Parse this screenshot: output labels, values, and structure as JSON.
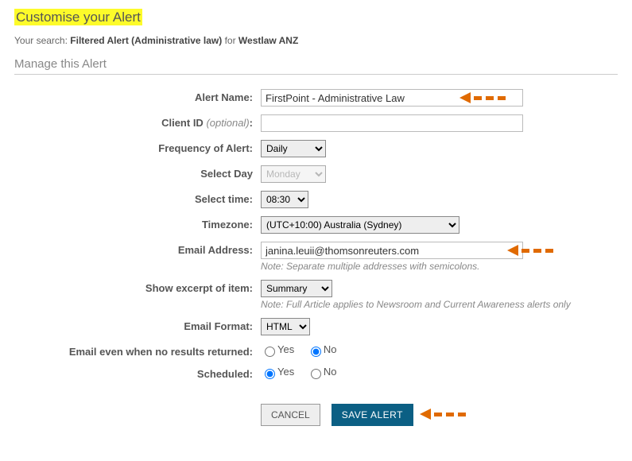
{
  "title": "Customise your Alert",
  "search_line": {
    "prefix": "Your search:",
    "query": "Filtered Alert (Administrative law)",
    "for": "for",
    "db": "Westlaw ANZ"
  },
  "section": "Manage this Alert",
  "labels": {
    "alert_name": "Alert Name:",
    "client_id": "Client ID",
    "client_id_opt": "(optional)",
    "client_id_colon": ":",
    "frequency": "Frequency of Alert:",
    "select_day": "Select Day",
    "select_time": "Select time:",
    "timezone": "Timezone:",
    "email": "Email Address:",
    "excerpt": "Show excerpt of item:",
    "format": "Email Format:",
    "no_results": "Email even when no results returned:",
    "scheduled": "Scheduled:"
  },
  "values": {
    "alert_name": "FirstPoint - Administrative Law",
    "client_id": "",
    "frequency": "Daily",
    "select_day": "Monday",
    "select_time": "08:30",
    "timezone": "(UTC+10:00) Australia (Sydney)",
    "email": "janina.leuii@thomsonreuters.com",
    "excerpt": "Summary",
    "format": "HTML"
  },
  "notes": {
    "email": "Note: Separate multiple addresses with semicolons.",
    "excerpt": "Note: Full Article applies to Newsroom and Current Awareness alerts only"
  },
  "options": {
    "yes": "Yes",
    "no": "No"
  },
  "radios": {
    "no_results": "no",
    "scheduled": "yes"
  },
  "buttons": {
    "cancel": "CANCEL",
    "save": "SAVE ALERT"
  }
}
